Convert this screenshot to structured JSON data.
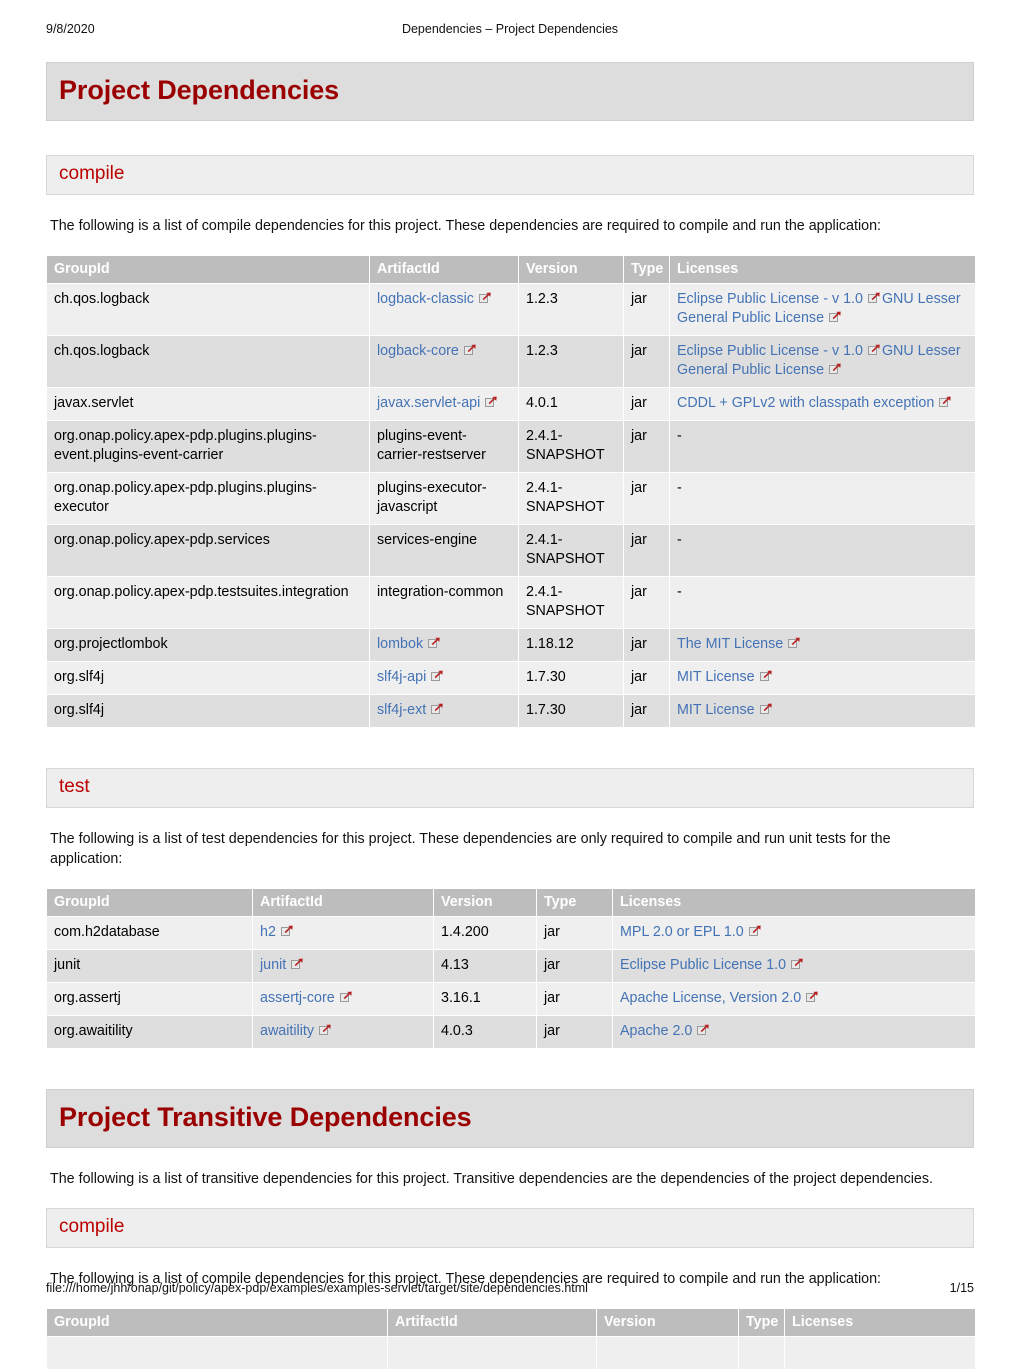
{
  "print_header": {
    "date": "9/8/2020",
    "title": "Dependencies – Project Dependencies"
  },
  "print_footer": {
    "url": "file:///home/jhh/onap/git/policy/apex-pdp/examples/examples-servlet/target/site/dependencies.html",
    "page": "1/15"
  },
  "colors": {
    "heading_red": "#9b0000",
    "subheading_red": "#bb0000",
    "link_blue": "#4473b5",
    "band_gray": "#dddddd",
    "subband_gray": "#eeeeee",
    "table_header_gray": "#bdbdbd",
    "row_odd": "#efefef",
    "row_even": "#dedede"
  },
  "icons": {
    "external_link": "external-link-icon"
  },
  "sections": {
    "project_dependencies": {
      "title": "Project Dependencies",
      "compile": {
        "heading": "compile",
        "intro": "The following is a list of compile dependencies for this project. These dependencies are required to compile and run the application:",
        "columns": [
          "GroupId",
          "ArtifactId",
          "Version",
          "Type",
          "Licenses"
        ],
        "rows": [
          {
            "group_id": "ch.qos.logback",
            "artifact_id": "logback-classic",
            "artifact_link": true,
            "version": "1.2.3",
            "type": "jar",
            "licenses": [
              {
                "text": "Eclipse Public License - v 1.0",
                "link": true
              },
              {
                "text": "GNU Lesser General Public License",
                "link": true
              }
            ]
          },
          {
            "group_id": "ch.qos.logback",
            "artifact_id": "logback-core",
            "artifact_link": true,
            "version": "1.2.3",
            "type": "jar",
            "licenses": [
              {
                "text": "Eclipse Public License - v 1.0",
                "link": true
              },
              {
                "text": "GNU Lesser General Public License",
                "link": true
              }
            ]
          },
          {
            "group_id": "javax.servlet",
            "artifact_id": "javax.servlet-api",
            "artifact_link": true,
            "version": "4.0.1",
            "type": "jar",
            "licenses": [
              {
                "text": "CDDL + GPLv2 with classpath exception",
                "link": true
              }
            ]
          },
          {
            "group_id": "org.onap.policy.apex-pdp.plugins.plugins-event.plugins-event-carrier",
            "artifact_id": "plugins-event-carrier-restserver",
            "artifact_link": false,
            "version": "2.4.1-SNAPSHOT",
            "type": "jar",
            "licenses": [
              {
                "text": "-",
                "link": false
              }
            ]
          },
          {
            "group_id": "org.onap.policy.apex-pdp.plugins.plugins-executor",
            "artifact_id": "plugins-executor-javascript",
            "artifact_link": false,
            "version": "2.4.1-SNAPSHOT",
            "type": "jar",
            "licenses": [
              {
                "text": "-",
                "link": false
              }
            ]
          },
          {
            "group_id": "org.onap.policy.apex-pdp.services",
            "artifact_id": "services-engine",
            "artifact_link": false,
            "version": "2.4.1-SNAPSHOT",
            "type": "jar",
            "licenses": [
              {
                "text": "-",
                "link": false
              }
            ]
          },
          {
            "group_id": "org.onap.policy.apex-pdp.testsuites.integration",
            "artifact_id": "integration-common",
            "artifact_link": false,
            "version": "2.4.1-SNAPSHOT",
            "type": "jar",
            "licenses": [
              {
                "text": "-",
                "link": false
              }
            ]
          },
          {
            "group_id": "org.projectlombok",
            "artifact_id": "lombok",
            "artifact_link": true,
            "version": "1.18.12",
            "type": "jar",
            "licenses": [
              {
                "text": "The MIT License",
                "link": true
              }
            ]
          },
          {
            "group_id": "org.slf4j",
            "artifact_id": "slf4j-api",
            "artifact_link": true,
            "version": "1.7.30",
            "type": "jar",
            "licenses": [
              {
                "text": "MIT License",
                "link": true
              }
            ]
          },
          {
            "group_id": "org.slf4j",
            "artifact_id": "slf4j-ext",
            "artifact_link": true,
            "version": "1.7.30",
            "type": "jar",
            "licenses": [
              {
                "text": "MIT License",
                "link": true
              }
            ]
          }
        ]
      },
      "test": {
        "heading": "test",
        "intro": "The following is a list of test dependencies for this project. These dependencies are only required to compile and run unit tests for the application:",
        "columns": [
          "GroupId",
          "ArtifactId",
          "Version",
          "Type",
          "Licenses"
        ],
        "rows": [
          {
            "group_id": "com.h2database",
            "artifact_id": "h2",
            "artifact_link": true,
            "version": "1.4.200",
            "type": "jar",
            "licenses": [
              {
                "text": "MPL 2.0 or EPL 1.0",
                "link": true
              }
            ]
          },
          {
            "group_id": "junit",
            "artifact_id": "junit",
            "artifact_link": true,
            "version": "4.13",
            "type": "jar",
            "licenses": [
              {
                "text": "Eclipse Public License 1.0",
                "link": true
              }
            ]
          },
          {
            "group_id": "org.assertj",
            "artifact_id": "assertj-core",
            "artifact_link": true,
            "version": "3.16.1",
            "type": "jar",
            "licenses": [
              {
                "text": "Apache License, Version 2.0",
                "link": true
              }
            ]
          },
          {
            "group_id": "org.awaitility",
            "artifact_id": "awaitility",
            "artifact_link": true,
            "version": "4.0.3",
            "type": "jar",
            "licenses": [
              {
                "text": "Apache 2.0",
                "link": true
              }
            ]
          }
        ]
      }
    },
    "project_transitive_dependencies": {
      "title": "Project Transitive Dependencies",
      "intro": "The following is a list of transitive dependencies for this project. Transitive dependencies are the dependencies of the project dependencies.",
      "compile": {
        "heading": "compile",
        "intro": "The following is a list of compile dependencies for this project. These dependencies are required to compile and run the application:",
        "columns": [
          "GroupId",
          "ArtifactId",
          "Version",
          "Type",
          "Licenses"
        ],
        "rows": []
      }
    }
  }
}
